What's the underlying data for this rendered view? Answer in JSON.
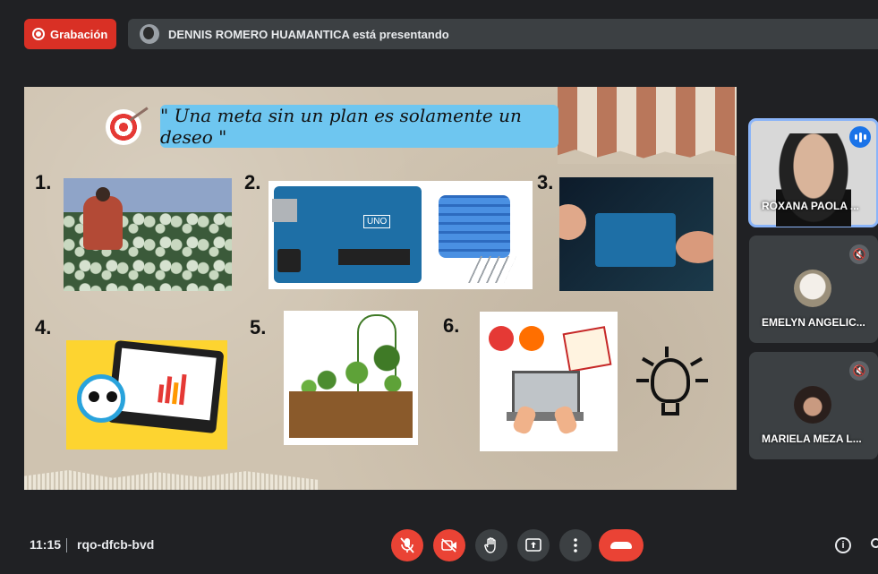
{
  "top": {
    "recording_label": "Grabación",
    "presenting_text": "DENNIS ROMERO HUAMANTICA está presentando"
  },
  "slide": {
    "quote": "\" Una meta sin un plan es solamente un deseo \"",
    "numbers": [
      "1.",
      "2.",
      "3.",
      "4.",
      "5.",
      "6."
    ],
    "arduino_label": "UNO"
  },
  "participants": [
    {
      "name": "ROXANA PAOLA ...",
      "status": "speaking"
    },
    {
      "name": "EMELYN ANGELIC...",
      "status": "muted"
    },
    {
      "name": "MARIELA MEZA L...",
      "status": "muted"
    }
  ],
  "bottom": {
    "time": "11:15",
    "meeting_code": "rqo-dfcb-bvd"
  },
  "colors": {
    "accent_red": "#ea4335",
    "speaking_blue": "#1a73e8",
    "tile_outline": "#8ab4f8",
    "bg": "#202124"
  },
  "icons": [
    "record-icon",
    "mic-off-icon",
    "camera-off-icon",
    "raise-hand-icon",
    "present-icon",
    "more-options-icon",
    "end-call-icon",
    "info-icon",
    "people-icon"
  ]
}
